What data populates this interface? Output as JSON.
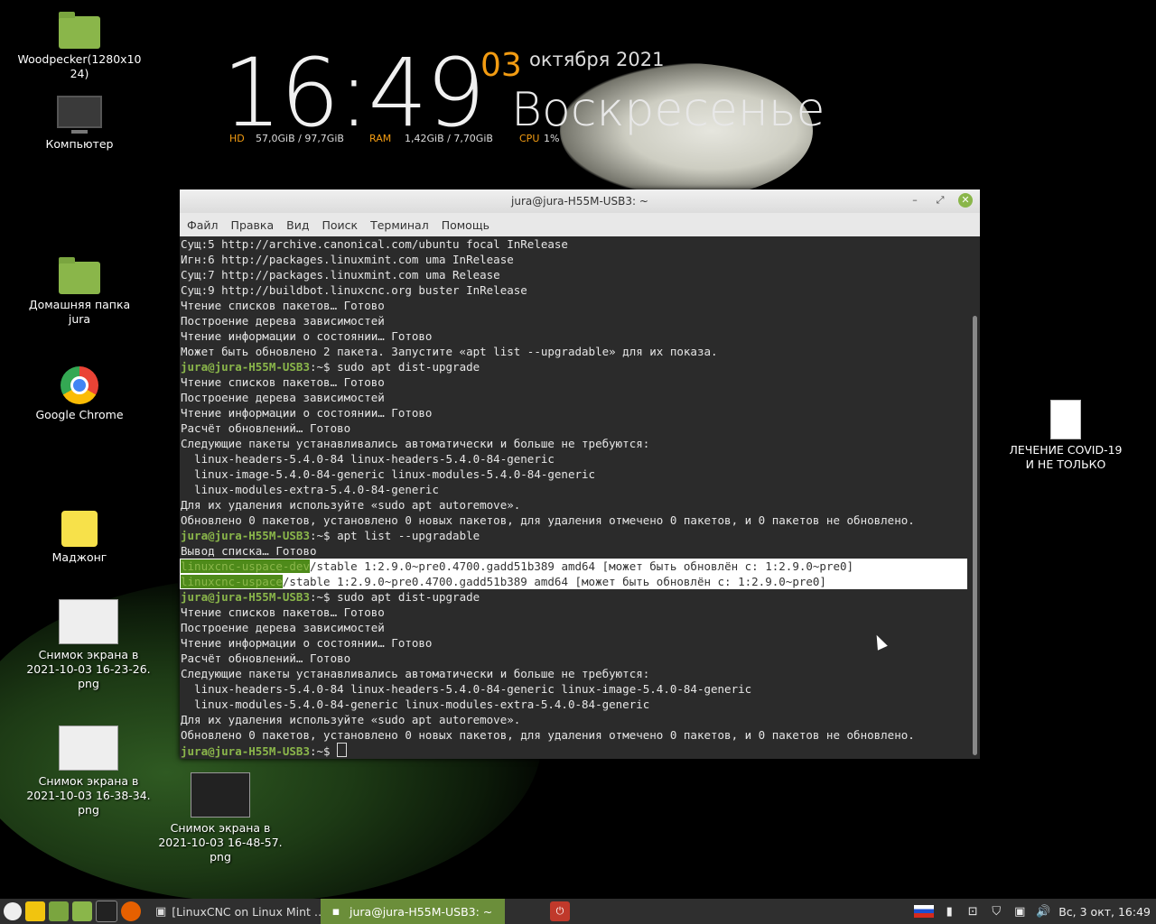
{
  "conky": {
    "time": "16:49",
    "day": "03",
    "month_year": "октября 2021",
    "weekday": "Воскресенье",
    "hd_label": "HD",
    "hd_value": "57,0GiB / 97,7GiB",
    "ram_label": "RAM",
    "ram_value": "1,42GiB / 7,70GiB",
    "cpu_label": "CPU",
    "cpu_value": "1%"
  },
  "desktop_icons": [
    {
      "label": "Woodpecker(1280x10\n24)"
    },
    {
      "label": "Компьютер"
    },
    {
      "label": "Домашняя папка jura"
    },
    {
      "label": "Google Chrome"
    },
    {
      "label": "Маджонг"
    },
    {
      "label": "Снимок экрана в\n2021-10-03 16-23-26.\npng"
    },
    {
      "label": "Снимок экрана в\n2021-10-03 16-38-34.\npng"
    },
    {
      "label": "Снимок экрана в\n2021-10-03 16-48-57.\npng"
    },
    {
      "label": "ЛЕЧЕНИЕ COVID-19\nИ НЕ ТОЛЬКО"
    }
  ],
  "terminal": {
    "title": "jura@jura-H55M-USB3: ~",
    "menu": [
      "Файл",
      "Правка",
      "Вид",
      "Поиск",
      "Терминал",
      "Помощь"
    ],
    "prompt": "jura@jura-H55M-USB3",
    "lines": [
      {
        "text": "Сущ:5 http://archive.canonical.com/ubuntu focal InRelease"
      },
      {
        "text": "Игн:6 http://packages.linuxmint.com uma InRelease"
      },
      {
        "text": "Сущ:7 http://packages.linuxmint.com uma Release"
      },
      {
        "text": "Сущ:9 http://buildbot.linuxcnc.org buster InRelease"
      },
      {
        "text": "Чтение списков пакетов… Готово"
      },
      {
        "text": "Построение дерева зависимостей"
      },
      {
        "text": "Чтение информации о состоянии… Готово"
      },
      {
        "text": "Может быть обновлено 2 пакета. Запустите «apt list --upgradable» для их показа."
      },
      {
        "cmd": ":~$ sudo apt dist-upgrade"
      },
      {
        "text": "Чтение списков пакетов… Готово"
      },
      {
        "text": "Построение дерева зависимостей"
      },
      {
        "text": "Чтение информации о состоянии… Готово"
      },
      {
        "text": "Расчёт обновлений… Готово"
      },
      {
        "text": "Следующие пакеты устанавливались автоматически и больше не требуются:"
      },
      {
        "text": "  linux-headers-5.4.0-84 linux-headers-5.4.0-84-generic"
      },
      {
        "text": "  linux-image-5.4.0-84-generic linux-modules-5.4.0-84-generic"
      },
      {
        "text": "  linux-modules-extra-5.4.0-84-generic"
      },
      {
        "text": "Для их удаления используйте «sudo apt autoremove»."
      },
      {
        "text": "Обновлено 0 пакетов, установлено 0 новых пакетов, для удаления отмечено 0 пакетов, и 0 пакетов не обновлено."
      },
      {
        "cmd": ":~$ apt list --upgradable"
      },
      {
        "text": "Вывод списка… Готово"
      },
      {
        "pkg": "linuxcnc-uspace-dev",
        "rest": "/stable 1:2.9.0~pre0.4700.gadd51b389 amd64 [может быть обновлён с: 1:2.9.0~pre0]"
      },
      {
        "pkg": "linuxcnc-uspace",
        "rest": "/stable 1:2.9.0~pre0.4700.gadd51b389 amd64 [может быть обновлён с: 1:2.9.0~pre0]"
      },
      {
        "cmd": ":~$ sudo apt dist-upgrade"
      },
      {
        "text": "Чтение списков пакетов… Готово"
      },
      {
        "text": "Построение дерева зависимостей"
      },
      {
        "text": "Чтение информации о состоянии… Готово"
      },
      {
        "text": "Расчёт обновлений… Готово"
      },
      {
        "text": "Следующие пакеты устанавливались автоматически и больше не требуются:"
      },
      {
        "text": "  linux-headers-5.4.0-84 linux-headers-5.4.0-84-generic linux-image-5.4.0-84-generic"
      },
      {
        "text": "  linux-modules-5.4.0-84-generic linux-modules-extra-5.4.0-84-generic"
      },
      {
        "text": "Для их удаления используйте «sudo apt autoremove»."
      },
      {
        "text": "Обновлено 0 пакетов, установлено 0 новых пакетов, для удаления отмечено 0 пакетов, и 0 пакетов не обновлено."
      },
      {
        "cmd": ":~$ ",
        "cursor": true
      }
    ]
  },
  "panel": {
    "tasks": [
      {
        "label": "[LinuxCNC on Linux Mint …",
        "active": false
      },
      {
        "label": "jura@jura-H55M-USB3: ~",
        "active": true
      }
    ],
    "clock": "Вс, 3 окт, 16:49",
    "icons": [
      "menu-icon",
      "linuxcnc-icon",
      "show-desktop-icon",
      "files-icon",
      "terminal-icon",
      "firefox-icon",
      "power-icon"
    ]
  }
}
